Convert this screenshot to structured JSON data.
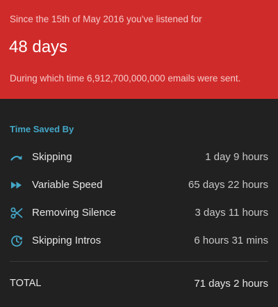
{
  "header": {
    "since_text": "Since the 15th of May 2016 you've listened for",
    "listened_duration": "48 days",
    "emails_text": "During which time 6,912,700,000,000 emails were sent.",
    "background_color": "#d02b2b"
  },
  "time_saved": {
    "title": "Time Saved By",
    "title_color": "#43a7c8",
    "items": [
      {
        "icon": "skip-arrow-icon",
        "label": "Skipping",
        "value": "1 day 9 hours"
      },
      {
        "icon": "fast-forward-icon",
        "label": "Variable Speed",
        "value": "65 days 22 hours"
      },
      {
        "icon": "scissors-icon",
        "label": "Removing Silence",
        "value": "3 days 11 hours"
      },
      {
        "icon": "skip-intro-clock-icon",
        "label": "Skipping Intros",
        "value": "6 hours 31 mins"
      }
    ]
  },
  "total": {
    "label": "TOTAL",
    "value": "71 days 2 hours"
  }
}
